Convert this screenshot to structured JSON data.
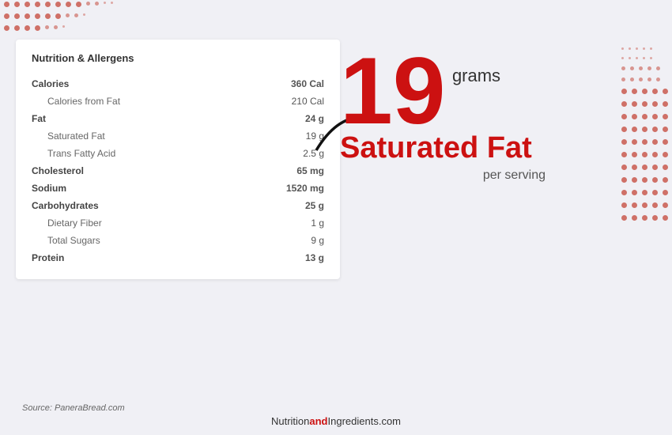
{
  "card": {
    "title": "Nutrition & Allergens",
    "rows": [
      {
        "label": "Calories",
        "value": "360 Cal",
        "type": "main"
      },
      {
        "label": "Calories from Fat",
        "value": "210 Cal",
        "type": "sub"
      },
      {
        "label": "Fat",
        "value": "24 g",
        "type": "main"
      },
      {
        "label": "Saturated Fat",
        "value": "19 g",
        "type": "sub"
      },
      {
        "label": "Trans Fatty Acid",
        "value": "2.5 g",
        "type": "sub"
      },
      {
        "label": "Cholesterol",
        "value": "65 mg",
        "type": "main"
      },
      {
        "label": "Sodium",
        "value": "1520 mg",
        "type": "main"
      },
      {
        "label": "Carbohydrates",
        "value": "25 g",
        "type": "main"
      },
      {
        "label": "Dietary Fiber",
        "value": "1 g",
        "type": "sub"
      },
      {
        "label": "Total Sugars",
        "value": "9 g",
        "type": "sub"
      },
      {
        "label": "Protein",
        "value": "13 g",
        "type": "main"
      }
    ]
  },
  "stat": {
    "number": "19",
    "unit": "grams",
    "label": "Saturated Fat",
    "sublabel": "per serving"
  },
  "source": "Source: PaneraBread.com",
  "footer": {
    "prefix": "Nutrition",
    "highlight": "and",
    "suffix": "Ingredients.com"
  }
}
